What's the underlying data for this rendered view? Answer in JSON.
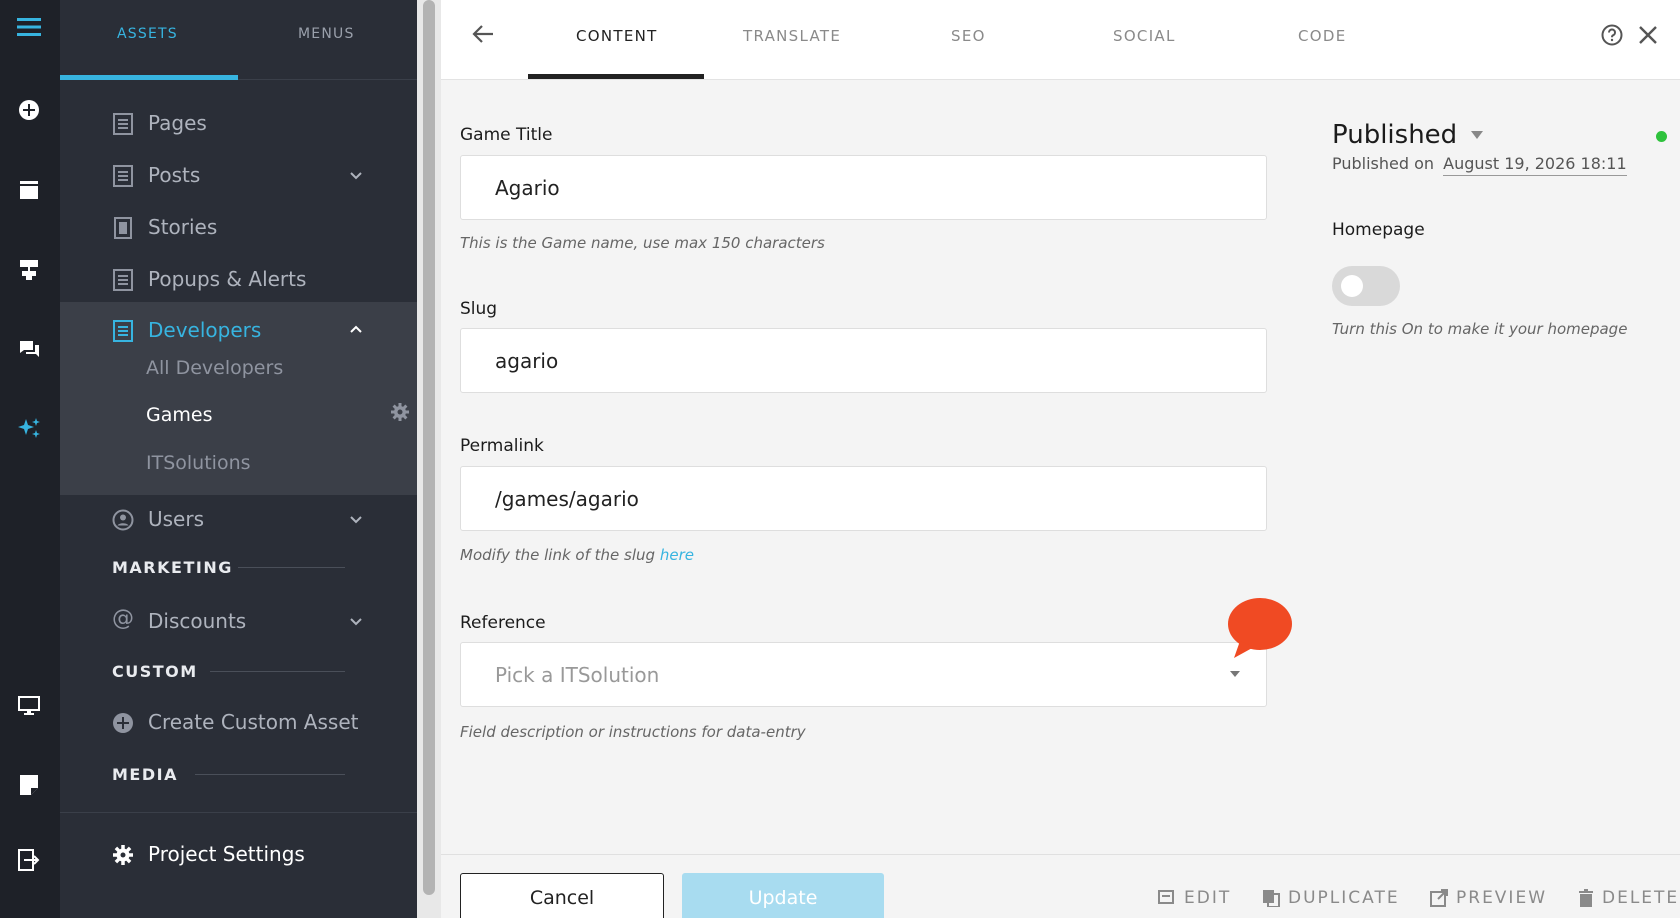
{
  "sidebar": {
    "tabs": [
      "ASSETS",
      "MENUS"
    ],
    "items": {
      "pages": "Pages",
      "posts": "Posts",
      "stories": "Stories",
      "popups": "Popups & Alerts",
      "developers": "Developers",
      "users": "Users",
      "discounts": "Discounts",
      "create_custom": "Create Custom Asset",
      "project_settings": "Project Settings"
    },
    "sub_items": [
      "All Developers",
      "Games",
      "ITSolutions"
    ],
    "sections": [
      "MARKETING",
      "CUSTOM",
      "MEDIA"
    ]
  },
  "topbar": {
    "tabs": [
      "CONTENT",
      "TRANSLATE",
      "SEO",
      "SOCIAL",
      "CODE"
    ],
    "active_tab": "CONTENT"
  },
  "form": {
    "game_title": {
      "label": "Game Title",
      "value": "Agario",
      "help": "This is the Game name, use max 150 characters"
    },
    "slug": {
      "label": "Slug",
      "value": "agario"
    },
    "permalink": {
      "label": "Permalink",
      "value": "/games/agario",
      "help_prefix": "Modify the link of the slug",
      "help_link": "here"
    },
    "reference": {
      "label": "Reference",
      "placeholder": "Pick a ITSolution",
      "help": "Field description or instructions for data-entry"
    }
  },
  "status": {
    "label": "Published",
    "published_on_prefix": "Published on",
    "published_on_date": "August 19, 2026 18:11",
    "homepage_label": "Homepage",
    "homepage_help": "Turn this On to make it your homepage",
    "homepage_on": false,
    "status_color": "#2ec23c"
  },
  "footer": {
    "cancel": "Cancel",
    "update": "Update",
    "actions": {
      "edit": "EDIT",
      "duplicate": "DUPLICATE",
      "preview": "PREVIEW",
      "delete": "DELETE"
    }
  },
  "colors": {
    "accent": "#37b4e0",
    "rail_bg": "#1e2128",
    "sidebar_bg": "#2a2e37",
    "update_btn": "#a8dcf0",
    "chat_bubble": "#f04a23"
  }
}
